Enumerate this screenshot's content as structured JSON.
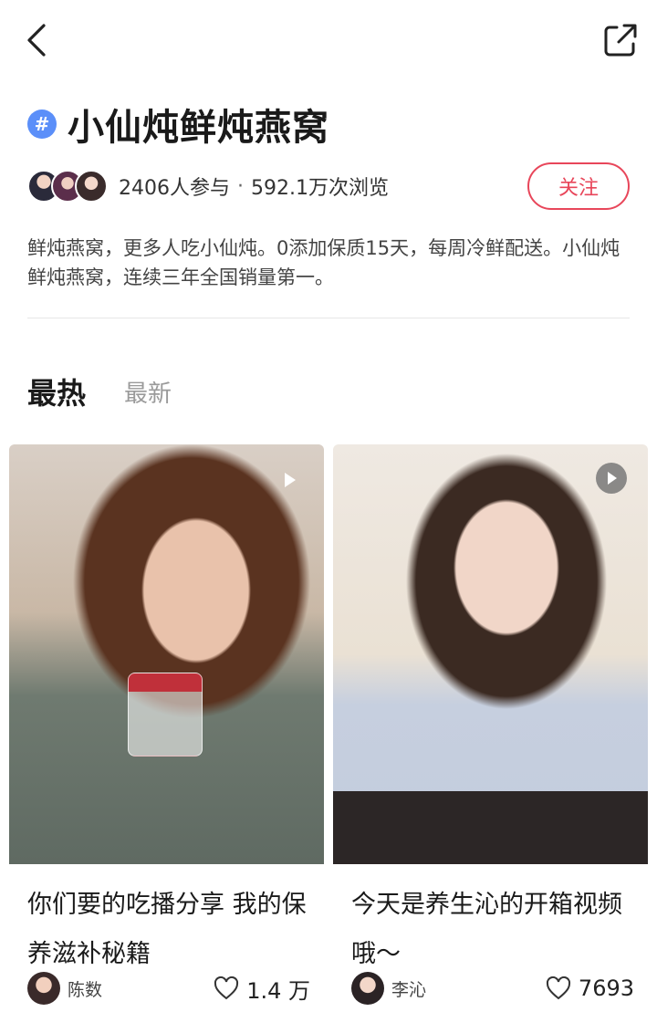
{
  "topic": {
    "title": "小仙炖鲜炖燕窝",
    "hash_symbol": "#",
    "participants": "2406人参与",
    "separator": "·",
    "views": "592.1万次浏览",
    "follow_label": "关注",
    "description": "鲜炖燕窝，更多人吃小仙炖。0添加保质15天，每周冷鲜配送。小仙炖鲜炖燕窝，连续三年全国销量第一。"
  },
  "tabs": [
    {
      "label": "最热",
      "active": true
    },
    {
      "label": "最新",
      "active": false
    }
  ],
  "posts": [
    {
      "title": "你们要的吃播分享 我的保养滋补秘籍",
      "author": "陈数",
      "likes": "1.4 万",
      "media_icon": "play-icon"
    },
    {
      "title": "今天是养生沁的开箱视频哦～",
      "author": "李沁",
      "likes": "7693",
      "media_icon": "play-icon"
    }
  ],
  "icons": {
    "back": "back-arrow-icon",
    "share": "share-icon",
    "like": "heart-icon"
  },
  "colors": {
    "accent": "#e8465a",
    "hash_badge": "#5b8ff9"
  }
}
